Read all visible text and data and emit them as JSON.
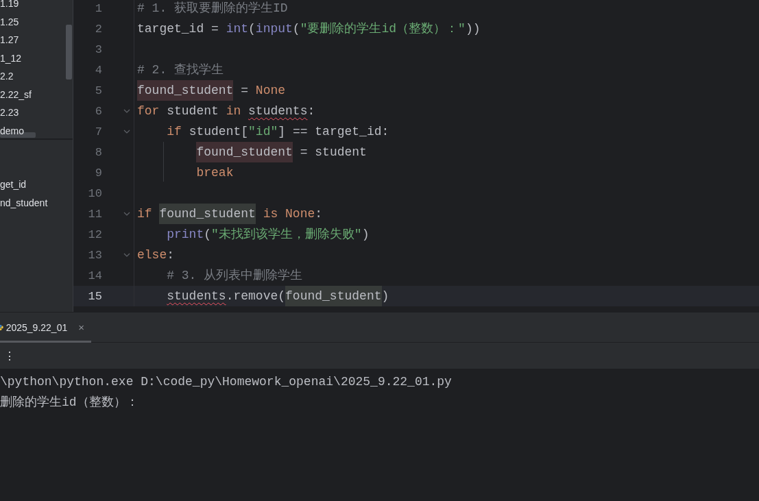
{
  "project_tree": {
    "items": [
      {
        "label": "1.19"
      },
      {
        "label": "1.25"
      },
      {
        "label": "1.27"
      },
      {
        "label": "1_12"
      },
      {
        "label": "2.2"
      },
      {
        "label": "2.22_sf"
      },
      {
        "label": "2.23"
      },
      {
        "label": "demo"
      }
    ]
  },
  "structure": {
    "items": [
      {
        "label": "get_id"
      },
      {
        "label": "nd_student"
      }
    ]
  },
  "editor": {
    "lines": [
      {
        "number": "1",
        "current": false,
        "fold": false,
        "tokens": [
          {
            "text": "# 1. 获取要删除的学生ID",
            "kind": "comment"
          }
        ]
      },
      {
        "number": "2",
        "current": false,
        "fold": false,
        "tokens": [
          {
            "text": "target_id = ",
            "kind": "plain"
          },
          {
            "text": "int",
            "kind": "builtin"
          },
          {
            "text": "(",
            "kind": "plain"
          },
          {
            "text": "input",
            "kind": "builtin"
          },
          {
            "text": "(",
            "kind": "plain"
          },
          {
            "text": "\"要删除的学生id（整数）：\"",
            "kind": "string"
          },
          {
            "text": "))",
            "kind": "plain"
          }
        ]
      },
      {
        "number": "3",
        "current": false,
        "fold": false
      },
      {
        "number": "4",
        "current": false,
        "fold": false,
        "tokens": [
          {
            "text": "# 2. 查找学生",
            "kind": "comment"
          }
        ]
      },
      {
        "number": "5",
        "current": false,
        "fold": false,
        "tokens": [
          {
            "text": "found_student",
            "kind": "write"
          },
          {
            "text": " = ",
            "kind": "plain"
          },
          {
            "text": "None",
            "kind": "keyword"
          }
        ]
      },
      {
        "number": "6",
        "current": false,
        "fold": true,
        "tokens": [
          {
            "text": "for",
            "kind": "keyword"
          },
          {
            "text": " student ",
            "kind": "plain"
          },
          {
            "text": "in ",
            "kind": "keyword"
          },
          {
            "text": "students",
            "kind": "typo"
          },
          {
            "text": ":",
            "kind": "plain"
          }
        ]
      },
      {
        "number": "7",
        "current": false,
        "fold": true,
        "tokens": [
          {
            "text": "    if",
            "kind": "keyword"
          },
          {
            "text": " student[",
            "kind": "plain"
          },
          {
            "text": "\"id\"",
            "kind": "string"
          },
          {
            "text": "] == target_id:",
            "kind": "plain"
          }
        ]
      },
      {
        "number": "8",
        "current": false,
        "fold": false,
        "tokens": [
          {
            "text": "        found_student",
            "kind": "write"
          },
          {
            "text": " = student",
            "kind": "plain"
          }
        ]
      },
      {
        "number": "9",
        "current": false,
        "fold": false,
        "tokens": [
          {
            "text": "        break",
            "kind": "keyword"
          }
        ]
      },
      {
        "number": "10",
        "current": false,
        "fold": false
      },
      {
        "number": "11",
        "current": false,
        "fold": true,
        "tokens": [
          {
            "text": "if ",
            "kind": "keyword"
          },
          {
            "text": "found_student",
            "kind": "read"
          },
          {
            "text": " is None",
            "kind": "keyword"
          },
          {
            "text": ":",
            "kind": "plain"
          }
        ]
      },
      {
        "number": "12",
        "current": false,
        "fold": false,
        "tokens": [
          {
            "text": "    print",
            "kind": "builtin"
          },
          {
            "text": "(",
            "kind": "plain"
          },
          {
            "text": "\"未找到该学生，删除失败\"",
            "kind": "string"
          },
          {
            "text": ")",
            "kind": "plain"
          }
        ]
      },
      {
        "number": "13",
        "current": false,
        "fold": true,
        "tokens": [
          {
            "text": "else",
            "kind": "keyword"
          },
          {
            "text": ":",
            "kind": "plain"
          }
        ]
      },
      {
        "number": "14",
        "current": false,
        "fold": false,
        "tokens": [
          {
            "text": "    # 3. 从列表中删除学生",
            "kind": "comment"
          }
        ]
      },
      {
        "number": "15",
        "current": true,
        "fold": false,
        "tokens": [
          {
            "text": "    students",
            "kind": "typo"
          },
          {
            "text": ".remove(",
            "kind": "plain"
          },
          {
            "text": "found_student",
            "kind": "read"
          },
          {
            "text": ")",
            "kind": "plain"
          }
        ]
      }
    ]
  },
  "run_panel": {
    "tabs": [
      {
        "label": "2025_9.22_01",
        "selected": true,
        "close": "×"
      }
    ],
    "more_button": "⋮",
    "output": [
      {
        "text": "\\python\\python.exe D:\\code_py\\Homework_openai\\2025_9.22_01.py"
      },
      {
        "text": "删除的学生id（整数）："
      }
    ]
  }
}
